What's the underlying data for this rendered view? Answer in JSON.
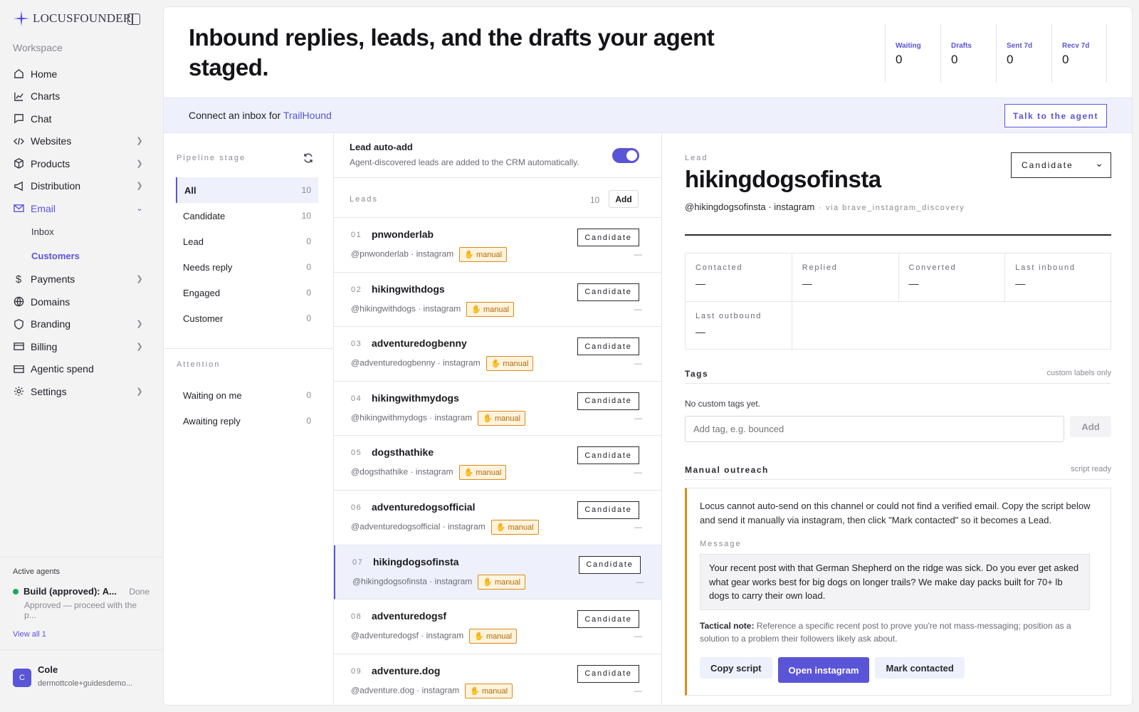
{
  "brand": {
    "name": "LOCUSFOUNDER"
  },
  "sidebar": {
    "workspace_label": "Workspace",
    "items": [
      {
        "label": "Home",
        "icon": "home-icon"
      },
      {
        "label": "Charts",
        "icon": "chart-icon"
      },
      {
        "label": "Chat",
        "icon": "chat-icon"
      },
      {
        "label": "Websites",
        "icon": "code-icon"
      },
      {
        "label": "Products",
        "icon": "box-icon"
      },
      {
        "label": "Distribution",
        "icon": "megaphone-icon"
      },
      {
        "label": "Email",
        "icon": "mail-icon"
      },
      {
        "label": "Payments",
        "icon": "dollar-icon"
      },
      {
        "label": "Domains",
        "icon": "globe-icon"
      },
      {
        "label": "Branding",
        "icon": "shield-icon"
      },
      {
        "label": "Billing",
        "icon": "card-icon"
      },
      {
        "label": "Agentic spend",
        "icon": "wallet-icon"
      },
      {
        "label": "Settings",
        "icon": "gear-icon"
      }
    ],
    "email_sub": [
      "Inbox",
      "Customers"
    ],
    "active_agents": {
      "title": "Active agents",
      "agent_name": "Build (approved): A...",
      "agent_status": "Done",
      "agent_sub": "Approved — proceed with the p...",
      "view_all": "View all 1"
    },
    "user": {
      "initial": "C",
      "name": "Cole",
      "email": "dermottcole+guidesdemo..."
    }
  },
  "header": {
    "headline": "Inbound replies, leads, and the drafts your agent staged.",
    "stats": [
      {
        "label": "Waiting",
        "value": "0"
      },
      {
        "label": "Drafts",
        "value": "0"
      },
      {
        "label": "Sent 7d",
        "value": "0"
      },
      {
        "label": "Recv 7d",
        "value": "0"
      }
    ]
  },
  "banner": {
    "text": "Connect an inbox for ",
    "link": "TrailHound",
    "button": "Talk to the agent"
  },
  "pipeline": {
    "title": "Pipeline stage",
    "stages": [
      {
        "label": "All",
        "count": "10"
      },
      {
        "label": "Candidate",
        "count": "10"
      },
      {
        "label": "Lead",
        "count": "0"
      },
      {
        "label": "Needs reply",
        "count": "0"
      },
      {
        "label": "Engaged",
        "count": "0"
      },
      {
        "label": "Customer",
        "count": "0"
      }
    ],
    "attention_title": "Attention",
    "attention": [
      {
        "label": "Waiting on me",
        "count": "0"
      },
      {
        "label": "Awaiting reply",
        "count": "0"
      }
    ]
  },
  "autoadd": {
    "title": "Lead auto-add",
    "subtitle": "Agent-discovered leads are added to the CRM automatically."
  },
  "leads": {
    "title": "Leads",
    "count": "10",
    "add_label": "Add",
    "badge": "✋ manual",
    "stage_label": "Candidate",
    "dash": "—",
    "items": [
      {
        "num": "01",
        "name": "pnwonderlab",
        "handle": "@pnwonderlab · instagram"
      },
      {
        "num": "02",
        "name": "hikingwithdogs",
        "handle": "@hikingwithdogs · instagram"
      },
      {
        "num": "03",
        "name": "adventuredogbenny",
        "handle": "@adventuredogbenny · instagram"
      },
      {
        "num": "04",
        "name": "hikingwithmydogs",
        "handle": "@hikingwithmydogs · instagram"
      },
      {
        "num": "05",
        "name": "dogsthathike",
        "handle": "@dogsthathike · instagram"
      },
      {
        "num": "06",
        "name": "adventuredogsofficial",
        "handle": "@adventuredogsofficial · instagram"
      },
      {
        "num": "07",
        "name": "hikingdogsofinsta",
        "handle": "@hikingdogsofinsta · instagram"
      },
      {
        "num": "08",
        "name": "adventuredogsf",
        "handle": "@adventuredogsf · instagram"
      },
      {
        "num": "09",
        "name": "adventure.dog",
        "handle": "@adventure.dog · instagram"
      }
    ]
  },
  "detail": {
    "label": "Lead",
    "name": "hikingdogsofinsta",
    "handle": "@hikingdogsofinsta · instagram",
    "via": "· via brave_instagram_discovery",
    "stage_select": "Candidate",
    "metrics": [
      {
        "label": "Contacted",
        "value": "—"
      },
      {
        "label": "Replied",
        "value": "—"
      },
      {
        "label": "Converted",
        "value": "—"
      },
      {
        "label": "Last inbound",
        "value": "—"
      },
      {
        "label": "Last outbound",
        "value": "—"
      }
    ],
    "tags_title": "Tags",
    "tags_right": "custom labels only",
    "no_tags": "No custom tags yet.",
    "tag_placeholder": "Add tag, e.g. bounced",
    "tag_add": "Add",
    "outreach_title": "Manual outreach",
    "outreach_right": "script ready",
    "outreach_intro": "Locus cannot auto-send on this channel or could not find a verified email. Copy the script below and send it manually via instagram, then click \"Mark contacted\" so it becomes a Lead.",
    "message_label": "Message",
    "message": "Your recent post with that German Shepherd on the ridge was sick. Do you ever get asked what gear works best for big dogs on longer trails? We make day packs built for 70+ lb dogs to carry their own load.",
    "tactical_label": "Tactical note:",
    "tactical": " Reference a specific recent post to prove you're not mass-messaging; position as a solution to a problem their followers likely ask about.",
    "buttons": {
      "copy": "Copy script",
      "open": "Open instagram",
      "mark": "Mark contacted"
    }
  }
}
